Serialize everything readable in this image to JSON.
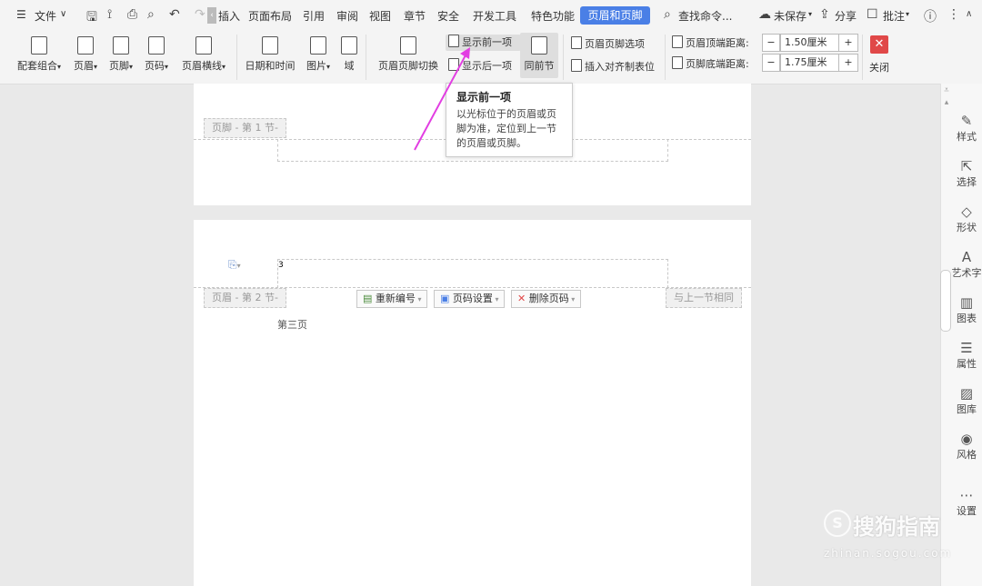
{
  "menubar": {
    "file": "文件",
    "tabs": [
      "插入",
      "页面布局",
      "引用",
      "审阅",
      "视图",
      "章节",
      "安全",
      "开发工具",
      "特色功能"
    ],
    "active_tab": "页眉和页脚",
    "search": "查找命令...",
    "unsaved": "未保存",
    "share": "分享",
    "comment": "批注"
  },
  "ribbon": {
    "combo": "配套组合",
    "header": "页眉",
    "footer": "页脚",
    "page_number": "页码",
    "header_line": "页眉横线",
    "date_time": "日期和时间",
    "picture": "图片",
    "field": "域",
    "switch": "页眉页脚切换",
    "show_prev": "显示前一项",
    "show_next": "显示后一项",
    "same_as_prev": "同前节",
    "options": "页眉页脚选项",
    "insert_tab": "插入对齐制表位",
    "header_top_label": "页眉顶端距离:",
    "header_top_value": "1.50厘米",
    "footer_bottom_label": "页脚底端距离:",
    "footer_bottom_value": "1.75厘米",
    "close": "关闭"
  },
  "tooltip": {
    "title": "显示前一项",
    "body": "以光标位于的页眉或页脚为准，定位到上一节的页眉或页脚。"
  },
  "document": {
    "footer_tag_1": "页脚 - 第 1 节-",
    "header_tag_2": "页眉 - 第 2 节-",
    "renumber": "重新编号",
    "page_settings": "页码设置",
    "delete_page_number": "删除页码",
    "same_as_prev_section": "与上一节相同",
    "header_number": "3",
    "body_text": "第三页"
  },
  "right_panel": {
    "items": [
      "样式",
      "选择",
      "形状",
      "艺术字",
      "图表",
      "属性",
      "图库",
      "风格",
      "设置"
    ]
  },
  "watermark": {
    "brand": "搜狗指南",
    "url": "zhinan.sogou.com"
  },
  "colors": {
    "accent": "#4a7fe6",
    "close_red": "#e04848",
    "arrow": "#e23ee2"
  }
}
